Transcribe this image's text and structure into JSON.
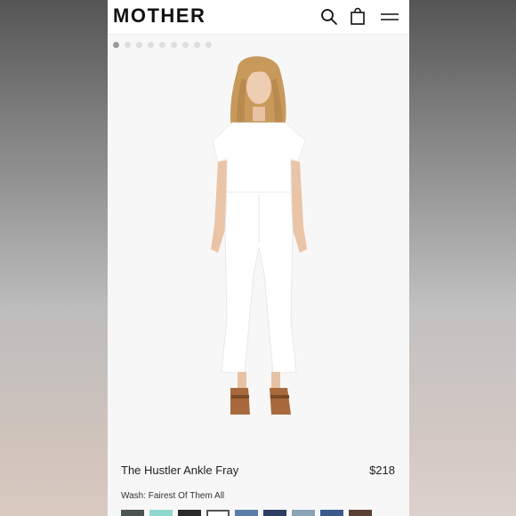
{
  "header": {
    "logo": "MOTHER",
    "icons": [
      "search-icon",
      "shopping-bag-icon",
      "menu-icon"
    ]
  },
  "gallery": {
    "image_count": 9,
    "active_index": 0
  },
  "product": {
    "title": "The Hustler Ankle Fray",
    "price": "$218",
    "wash_label": "Wash: Fairest Of Them All"
  },
  "swatches": [
    {
      "color": "#4a5450"
    },
    {
      "color": "#8fd8cf"
    },
    {
      "color": "#2a2a2a"
    },
    {
      "color": "#ffffff",
      "selected": true
    },
    {
      "color": "#5a7ea8"
    },
    {
      "color": "#2c3f63"
    },
    {
      "color": "#8aa3b5"
    },
    {
      "color": "#3b5a8c"
    },
    {
      "color": "#5a3f35"
    }
  ]
}
